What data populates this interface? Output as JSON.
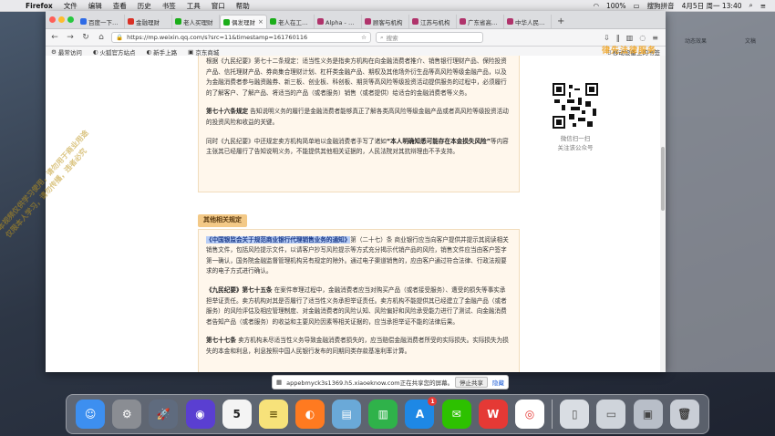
{
  "menubar": {
    "app_name": "Firefox",
    "items": [
      "文件",
      "编辑",
      "查看",
      "历史",
      "书签",
      "工具",
      "窗口",
      "帮助"
    ],
    "status": {
      "battery_percent": "100%",
      "time": "4月5日 周一 13:40",
      "input_method": "搜狗拼音"
    }
  },
  "browser": {
    "tabs": [
      {
        "label": "百度一下，你",
        "color": "#2e6be6"
      },
      {
        "label": "金融理财",
        "color": "#d93025"
      },
      {
        "label": "老人买理财",
        "color": "#1aad19"
      },
      {
        "label": "偶发理财",
        "color": "#1aad19",
        "active": true
      },
      {
        "label": "老人在工行买",
        "color": "#1aad19"
      },
      {
        "label": "Alpha - 案例",
        "color": "#b0336b"
      },
      {
        "label": "顾客与机构",
        "color": "#b0336b"
      },
      {
        "label": "江苏与机构",
        "color": "#b0336b"
      },
      {
        "label": "广东省高级人",
        "color": "#b0336b"
      },
      {
        "label": "中华人民共和",
        "color": "#b0336b"
      }
    ],
    "url": "https://mp.weixin.qq.com/s?src=11&timestamp=161760116",
    "search_placeholder": "搜索",
    "bookmarks": [
      "最常访问",
      "火狐官方站点",
      "新手上路",
      "京东商城"
    ],
    "bookmarks_right": [
      "移动设备上的书签"
    ]
  },
  "article": {
    "para1": "根据《九民纪要》第七十二条规定：适当性义务是指卖方机构在向金融消费者推介、销售银行理财产品、保险投资产品、信托理财产品、券商集合理财计划、杠杆类金融产品、期权及其他场外衍生品等高风险等级金融产品，以及为金融消费者参与融资融券、新三板、创业板、科创板、期货等高风险等级投资活动提供服务的过程中，必须履行的了解客户、了解产品、将适当的产品（或者服务）销售（或者提供）给适合的金融消费者等义务。",
    "para2_bold": "第七十六条规定",
    "para2_rest": "告知说明义务的履行是金融消费者能够真正了解各类高风险等级金融产品或者高风险等级投资活动的投资风险和收益的关键。",
    "para3_a": "同时《九民纪要》中还规定卖方机构简单地以金融消费者手写了诸如",
    "para3_bold": "“本人明确知悉可能存在本金损失风险”",
    "para3_b": "等内容主张其已经履行了告知说明义务，不能提供其他相关证据的，人民法院对其抗辩理由不予支持。",
    "section_title": "其他相关规定",
    "para4_hl": "《中国银监会关于规范商业银行代理销售业务的通知》",
    "para4_a": "第（二十七）条 商业银行应当向客户提供并提示其阅读相关销售文件，包括风险提示文件，以请客户抄写风险提示等方式充分揭示代销产品的风险，销售文件应当由客户签字第一确认，国务院金融监督管理机构另有规定的除外。通过电子渠道销售的，应由客户通过符合法律、行政法规要求的电子方式进行确认。",
    "para5_bold": "《九民纪要》第七十五条",
    "para5_rest": "在案件审理过程中，金融消费者应当对购买产品（或者接受服务）、遭受的损失等事实承担举证责任。卖方机构对其是否履行了适当性义务承担举证责任。卖方机构不能提供其已经建立了金融产品（或者服务）的风险评估及相应管理制度、对金融消费者的风险认知、风险偏好和风险承受能力进行了测试、向金融消费者告知产品（或者服务）的收益和主要风险因素等相关证据的，应当承担举证不能的法律后果。",
    "para6_bold": "第七十七条",
    "para6_rest": "卖方机构未尽适当性义务导致金融消费者损失的，应当赔偿金融消费者所受的实际损失。实际损失为损失的本金和利息，利息按照中国人民银行发布的同期同类存款基准利率计算。"
  },
  "sidebar": {
    "caption_line1": "微信扫一扫",
    "caption_line2": "关注该公众号"
  },
  "overlay": {
    "logo_text": "律先法律服务",
    "watermark_lines": [
      "本视频仅供学习使用，请勿用于商业用途",
      "仅限本人学习，请勿传播，违者必究"
    ],
    "right_app_labels": [
      "动态效果",
      "文稿"
    ]
  },
  "share_notice": {
    "text": "appebmyck3s1369.h5.xiaoeknow.com正在共享您的屏幕。",
    "stop_label": "停止共享",
    "hide_label": "隐藏"
  },
  "dock": [
    {
      "name": "finder-icon",
      "glyph": "☺",
      "color": "#3d8ff0"
    },
    {
      "name": "system-preferences-icon",
      "glyph": "⚙",
      "color": "#8a8d93"
    },
    {
      "name": "launchpad-icon",
      "glyph": "🚀",
      "color": "#5f6b7e"
    },
    {
      "name": "siri-icon",
      "glyph": "◉",
      "color": "#5a3fd1"
    },
    {
      "name": "calendar-icon",
      "glyph": "5",
      "color": "#f4f4f4",
      "fg": "#222"
    },
    {
      "name": "notes-icon",
      "glyph": "≡",
      "color": "#f7e27a",
      "fg": "#6b5a10"
    },
    {
      "name": "firefox-icon",
      "glyph": "◐",
      "color": "#ff7a20"
    },
    {
      "name": "preview-icon",
      "glyph": "▤",
      "color": "#6aa9d8"
    },
    {
      "name": "numbers-icon",
      "glyph": "▥",
      "color": "#2fb24a"
    },
    {
      "name": "app-store-icon",
      "glyph": "A",
      "color": "#1e88e5",
      "badge": "1"
    },
    {
      "name": "wechat-icon",
      "glyph": "✉",
      "color": "#2dc100"
    },
    {
      "name": "wps-icon",
      "glyph": "W",
      "color": "#e53935"
    },
    {
      "name": "chrome-icon",
      "glyph": "◎",
      "color": "#ffffff",
      "fg": "#e53935"
    },
    {
      "name": "document-icon",
      "glyph": "▯",
      "color": "#d9dde3",
      "fg": "#555"
    },
    {
      "name": "downloads-icon",
      "glyph": "▭",
      "color": "#cfd4db",
      "fg": "#555"
    },
    {
      "name": "screenshot-icon",
      "glyph": "▣",
      "color": "#b8bec8",
      "fg": "#444"
    },
    {
      "name": "trash-icon",
      "glyph": "🗑",
      "color": "#c9ced6",
      "fg": "#444"
    }
  ]
}
